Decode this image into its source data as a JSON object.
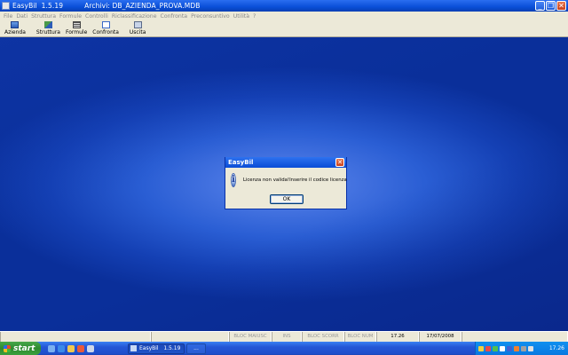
{
  "window": {
    "app_name": "EasyBil",
    "version": "1.5.19",
    "archive_text": "Archivi: DB_AZIENDA_PROVA.MDB",
    "buttons": {
      "minimize": "_",
      "restore": "❐",
      "close": "✕"
    }
  },
  "menu": {
    "items": [
      "File",
      "Dati",
      "Struttura",
      "Formule",
      "Controlli",
      "Riclassificazione",
      "Confronta",
      "Preconsuntivo",
      "Utilità",
      "?"
    ]
  },
  "toolbar": {
    "items": [
      {
        "label": "Azienda",
        "icon": "company-icon"
      },
      {
        "label": "Struttura",
        "icon": "structure-icon"
      },
      {
        "label": "Formule",
        "icon": "formula-icon"
      },
      {
        "label": "Confronta",
        "icon": "compare-icon"
      },
      {
        "label": "Uscita",
        "icon": "exit-icon"
      }
    ]
  },
  "dialog": {
    "title": "EasyBil",
    "close": "✕",
    "icon": "info-icon",
    "icon_glyph": "i",
    "message": "Licenza non valida!Inserire il codice licenza",
    "ok_label": "OK"
  },
  "statusbar": {
    "caps": "BLOC MAIUSC",
    "ins": "INS",
    "scroll": "BLOC SCORR",
    "num": "BLOC NUM",
    "time": "17.26",
    "date": "17/07/2008"
  },
  "taskbar": {
    "start_label": "start",
    "task_label": "EasyBil   1.5.19",
    "task2_label": "...",
    "clock": "17.26"
  },
  "colors": {
    "titlebar": "#0a4fd8",
    "desktop": "#1440b4",
    "taskbar": "#2456d6",
    "start": "#2e8a2f"
  }
}
